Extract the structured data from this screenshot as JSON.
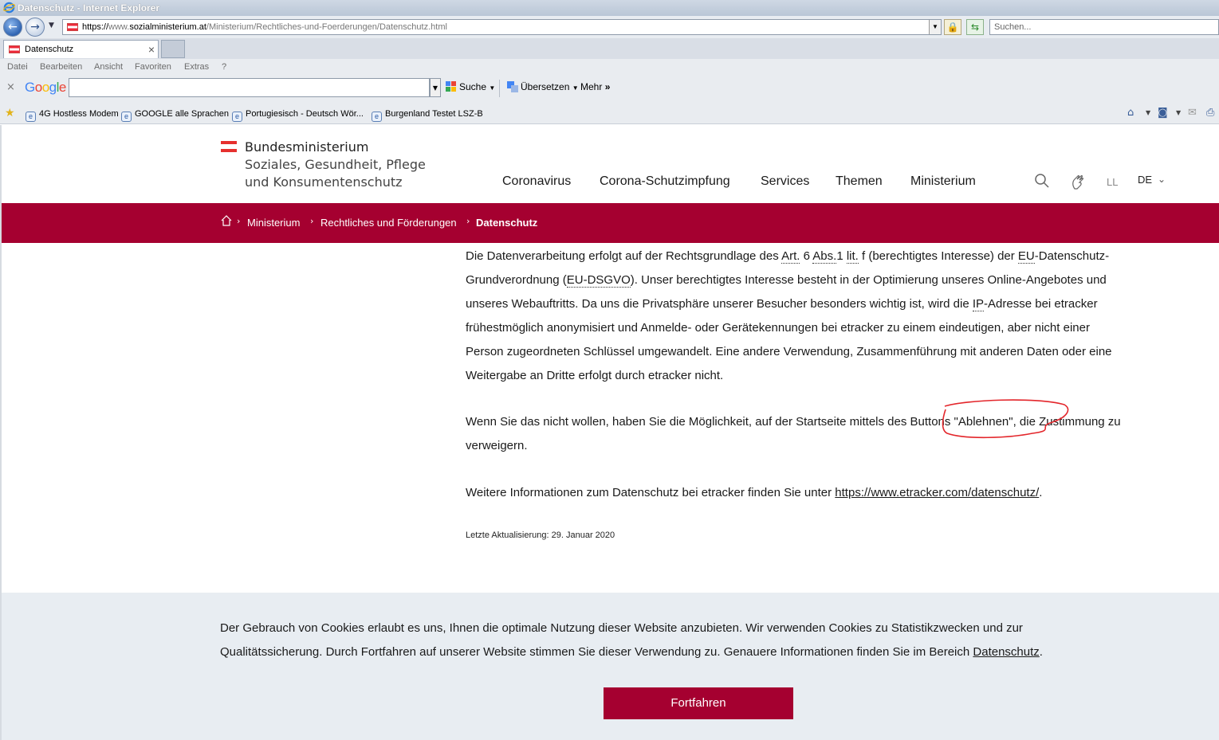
{
  "window": {
    "title": "Datenschutz - Internet Explorer"
  },
  "address_bar": {
    "protocol": "https://",
    "prefix": "www.",
    "host": "sozialministerium.at",
    "path": "/Ministerium/Rechtliches-und-Foerderungen/Datenschutz.html",
    "search_placeholder": "Suchen..."
  },
  "tabs": [
    {
      "label": "Datenschutz",
      "close": "×"
    }
  ],
  "menu": [
    "Datei",
    "Bearbeiten",
    "Ansicht",
    "Favoriten",
    "Extras",
    "?"
  ],
  "google_toolbar": {
    "close": "×",
    "logo": [
      "G",
      "o",
      "o",
      "g",
      "l",
      "e"
    ],
    "logo_colors": [
      "#4285f4",
      "#ea4335",
      "#fbbc05",
      "#4285f4",
      "#34a853",
      "#ea4335"
    ],
    "search_label": "Suche",
    "translate_label": "Übersetzen",
    "more_label": "Mehr"
  },
  "favorites": [
    "4G Hostless Modem",
    "GOOGLE alle Sprachen",
    "Portugiesisch - Deutsch Wör...",
    "Burgenland Testet  LSZ-B"
  ],
  "site": {
    "logo": {
      "line1": "Bundesministerium",
      "line2": "Soziales, Gesundheit, Pflege",
      "line3": "und Konsumentenschutz"
    },
    "nav": [
      "Coronavirus",
      "Corona-Schutzimpfung",
      "Services",
      "Themen",
      "Ministerium"
    ],
    "easy_language": "LL",
    "language": "DE",
    "brand_color": "#a50030"
  },
  "breadcrumb": [
    "Ministerium",
    "Rechtliches und Förderungen",
    "Datenschutz"
  ],
  "content": {
    "p1": {
      "a": "Die Datenverarbeitung erfolgt auf der Rechtsgrundlage des ",
      "art": "Art.",
      "b": " 6 ",
      "abs": "Abs.",
      "c": "1 ",
      "lit": "lit.",
      "d": " f (berechtigtes Interesse) der ",
      "eu": "EU",
      "e": "-Datenschutz-",
      "line2a": "Grundverordnung (",
      "eudsgvo": "EU-DSGVO",
      "line2b": "). Unser berechtigtes Interesse besteht in der Optimierung unseres Online-Angebotes und",
      "line3": "unseres Webauftritts. Da uns die Privatsphäre unserer Besucher besonders wichtig ist, wird die ",
      "ip": "IP",
      "line3b": "-Adresse bei etracker",
      "line4": "frühestmöglich anonymisiert und Anmelde- oder Gerätekennungen bei etracker zu einem eindeutigen, aber nicht einer",
      "line5": "Person zugeordneten Schlüssel umgewandelt. Eine andere Verwendung, Zusammenführung mit anderen Daten oder eine",
      "line6": "Weitergabe an Dritte erfolgt durch etracker nicht."
    },
    "p2": {
      "line1": "Wenn Sie das nicht wollen, haben Sie die Möglichkeit, auf der Startseite mittels des Buttons \"Ablehnen\", die Zustimmung zu",
      "line2": "verweigern."
    },
    "p3": {
      "text": "Weitere Informationen zum Datenschutz bei etracker finden Sie unter ",
      "link": "https://www.etracker.com/datenschutz/",
      "end": "."
    },
    "updated": "Letzte Aktualisierung: 29. Januar 2020"
  },
  "cookie_banner": {
    "line1": "Der Gebrauch von Cookies erlaubt es uns, Ihnen die optimale Nutzung dieser Website anzubieten. Wir verwenden Cookies zu Statistikzwecken und zur",
    "line2": "Qualitätssicherung. Durch Fortfahren auf unserer Website stimmen Sie dieser Verwendung zu. Genauere Informationen finden Sie im Bereich ",
    "link": "Datenschutz",
    "end": ".",
    "button": "Fortfahren"
  }
}
